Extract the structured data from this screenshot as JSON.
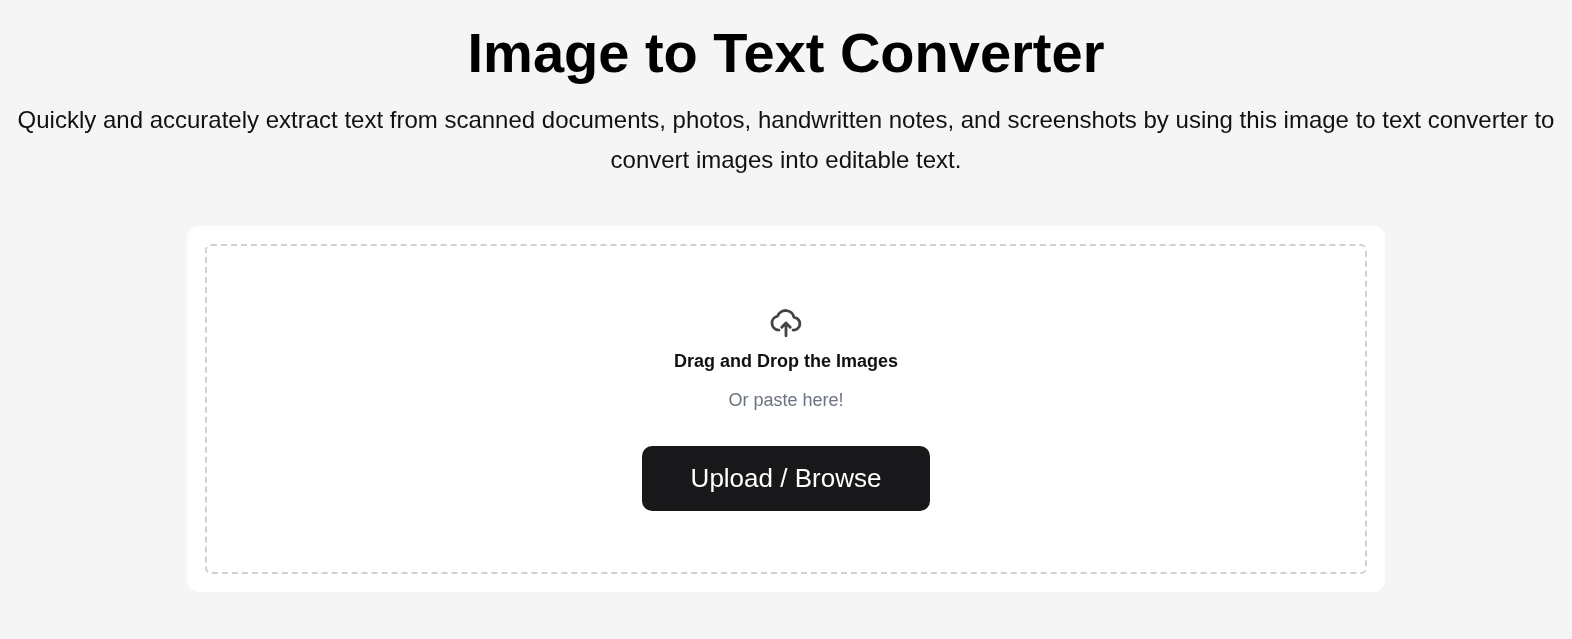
{
  "title": "Image to Text Converter",
  "description": "Quickly and accurately extract text from scanned documents, photos, handwritten notes, and screenshots by using this image to text converter to convert images into editable text.",
  "dropzone": {
    "heading": "Drag and Drop the Images",
    "hint": "Or paste here!",
    "button": "Upload / Browse"
  }
}
